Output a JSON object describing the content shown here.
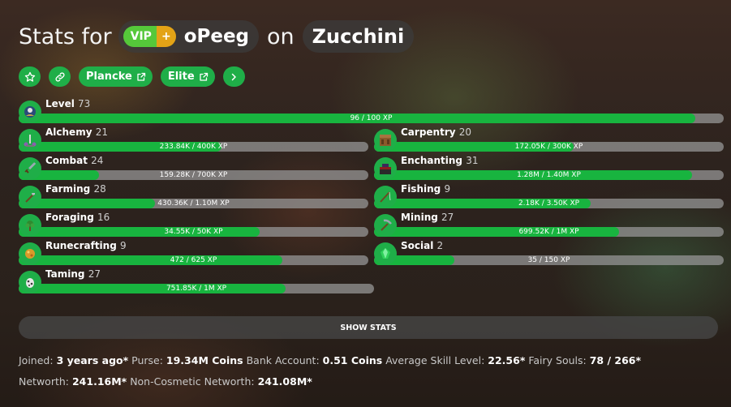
{
  "header": {
    "title_prefix": "Stats for",
    "rank_label": "VIP",
    "rank_plus": "+",
    "player_name": "oPeeg",
    "on_text": "on",
    "profile_name": "Zucchini"
  },
  "links": {
    "plancke": "Plancke",
    "elite": "Elite"
  },
  "level": {
    "label": "Level",
    "level": "73",
    "xp": "96 / 100 XP",
    "progress": 0.96
  },
  "skills": [
    {
      "name": "Alchemy",
      "level": "21",
      "xp": "233.84K / 400K XP",
      "progress": 0.58,
      "icon": "brewing-stand-icon"
    },
    {
      "name": "Carpentry",
      "level": "20",
      "xp": "172.05K / 300K XP",
      "progress": 0.57,
      "icon": "crafting-table-icon"
    },
    {
      "name": "Combat",
      "level": "24",
      "xp": "159.28K / 700K XP",
      "progress": 0.23,
      "icon": "sword-icon"
    },
    {
      "name": "Enchanting",
      "level": "31",
      "xp": "1.28M / 1.40M XP",
      "progress": 0.91,
      "icon": "enchanting-table-icon"
    },
    {
      "name": "Farming",
      "level": "28",
      "xp": "430.36K / 1.10M XP",
      "progress": 0.39,
      "icon": "hoe-icon"
    },
    {
      "name": "Fishing",
      "level": "9",
      "xp": "2.18K / 3.50K XP",
      "progress": 0.62,
      "icon": "fishing-rod-icon"
    },
    {
      "name": "Foraging",
      "level": "16",
      "xp": "34.55K / 50K XP",
      "progress": 0.69,
      "icon": "sapling-icon"
    },
    {
      "name": "Mining",
      "level": "27",
      "xp": "699.52K / 1M XP",
      "progress": 0.7,
      "icon": "pickaxe-icon"
    },
    {
      "name": "Runecrafting",
      "level": "9",
      "xp": "472 / 625 XP",
      "progress": 0.755,
      "icon": "magma-cream-icon"
    },
    {
      "name": "Social",
      "level": "2",
      "xp": "35 / 150 XP",
      "progress": 0.23,
      "icon": "emerald-icon"
    },
    {
      "name": "Taming",
      "level": "27",
      "xp": "751.85K / 1M XP",
      "progress": 0.75,
      "icon": "spawn-egg-icon"
    }
  ],
  "show_stats_label": "SHOW STATS",
  "summary": {
    "joined_label": "Joined:",
    "joined_value": "3 years ago*",
    "purse_label": "Purse:",
    "purse_value": "19.34M Coins",
    "bank_label": "Bank Account:",
    "bank_value": "0.51 Coins",
    "avg_label": "Average Skill Level:",
    "avg_value": "22.56*",
    "fairy_label": "Fairy Souls:",
    "fairy_value": "78 / 266*",
    "networth_label": "Networth:",
    "networth_value": "241.16M*",
    "noncos_label": "Non-Cosmetic Networth:",
    "noncos_value": "241.08M*"
  },
  "colors": {
    "accent_green": "#1fae48",
    "bar_fill": "#18b43f",
    "bar_track": "#969696",
    "rank_green": "#55c83a",
    "rank_gold": "#e3a316"
  }
}
